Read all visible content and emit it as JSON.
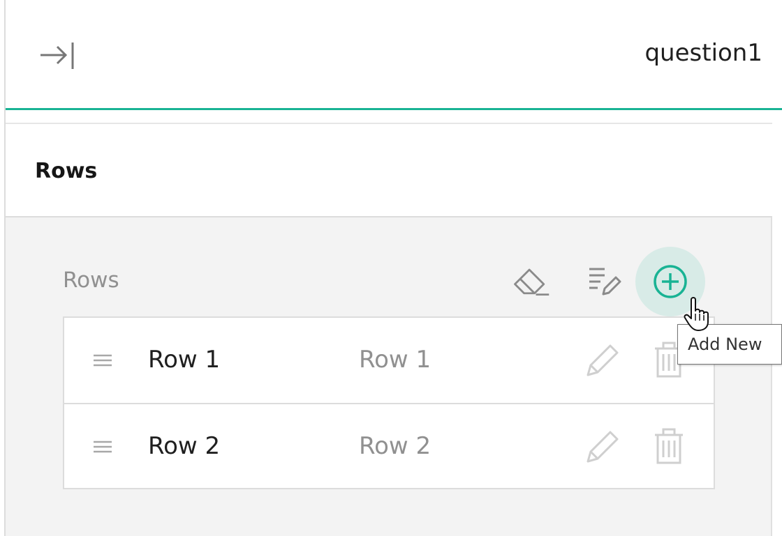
{
  "header": {
    "collapse_icon": "collapse-right-icon",
    "object_name": "question1",
    "accent_color": "#19b394"
  },
  "section": {
    "title": "Rows"
  },
  "editor": {
    "label": "Rows",
    "actions": [
      {
        "name": "clear",
        "icon": "eraser-icon"
      },
      {
        "name": "edit",
        "icon": "list-edit-icon"
      },
      {
        "name": "add-new",
        "icon": "plus-circle-icon"
      }
    ],
    "items": [
      {
        "value": "Row 1",
        "text": "Row 1"
      },
      {
        "value": "Row 2",
        "text": "Row 2"
      }
    ]
  },
  "tooltip": {
    "text": "Add New"
  }
}
